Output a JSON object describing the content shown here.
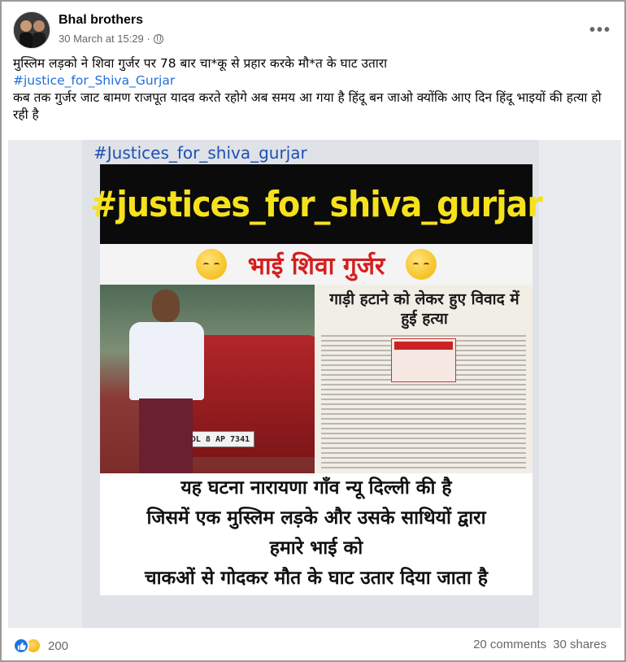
{
  "post": {
    "author": "Bhal brothers",
    "date": "30 March at 15:29 ·",
    "more_label": "•••",
    "text_line1": "मुस्लिम लड़को ने शिवा गुर्जर पर 78 बार चा*कू से प्रहार करके मौ*त के घाट उतारा",
    "hashtag": "#justice_for_Shiva_Gurjar",
    "text_line2": "कब तक गुर्जर जाट बामण राजपूत यादव करते रहोगे अब समय आ गया है हिंदू बन जाओ क्योंकि आए दिन हिंदू भाइयों की हत्या हो रही है"
  },
  "image": {
    "top_tag": "#Justices_for_shiva_gurjar",
    "banner": "#justices_for_shiva_gurjar",
    "red_title": "भाई शिवा गुर्जर",
    "plate": "DL 8 AP 7341",
    "news_headline": "गाड़ी हटाने को लेकर हुए विवाद में हुई हत्या",
    "caption": [
      "यह घटना नारायणा गाँव न्यू दिल्ली की है",
      "जिसमें एक मुस्लिम लड़के और उसके साथियों द्वारा",
      "हमारे भाई को",
      "चाकओं से गोदकर मौत के घाट उतार दिया जाता है"
    ]
  },
  "footer": {
    "reaction_count": "200",
    "comments": "20 comments",
    "shares": "30 shares"
  }
}
